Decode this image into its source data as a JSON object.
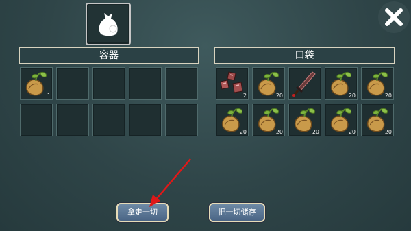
{
  "container": {
    "title": "容器",
    "slots": [
      {
        "item": "seed-icon",
        "count": "1"
      },
      {
        "item": "",
        "count": ""
      },
      {
        "item": "",
        "count": ""
      },
      {
        "item": "",
        "count": ""
      },
      {
        "item": "",
        "count": ""
      },
      {
        "item": "",
        "count": ""
      },
      {
        "item": "",
        "count": ""
      },
      {
        "item": "",
        "count": ""
      },
      {
        "item": "",
        "count": ""
      },
      {
        "item": "",
        "count": ""
      }
    ]
  },
  "pocket": {
    "title": "口袋",
    "slots": [
      {
        "item": "meat-icon",
        "count": "2"
      },
      {
        "item": "seed-icon",
        "count": "20"
      },
      {
        "item": "sword-icon",
        "count": ""
      },
      {
        "item": "seed-icon",
        "count": "20"
      },
      {
        "item": "seed-icon",
        "count": "20"
      },
      {
        "item": "seed-icon",
        "count": "20"
      },
      {
        "item": "seed-icon",
        "count": "20"
      },
      {
        "item": "seed-icon",
        "count": "20"
      },
      {
        "item": "seed-icon",
        "count": "20"
      },
      {
        "item": "seed-icon",
        "count": "20"
      }
    ]
  },
  "buttons": {
    "take_all": "拿走一切",
    "store_all": "把一切储存"
  },
  "icons": {
    "badge": "bag-icon",
    "close": "close-icon",
    "annotation": "red-arrow"
  },
  "colors": {
    "background": "#2f4548",
    "button": "#5a7595",
    "button_border": "#e6dcb8",
    "arrow": "#e01818"
  }
}
